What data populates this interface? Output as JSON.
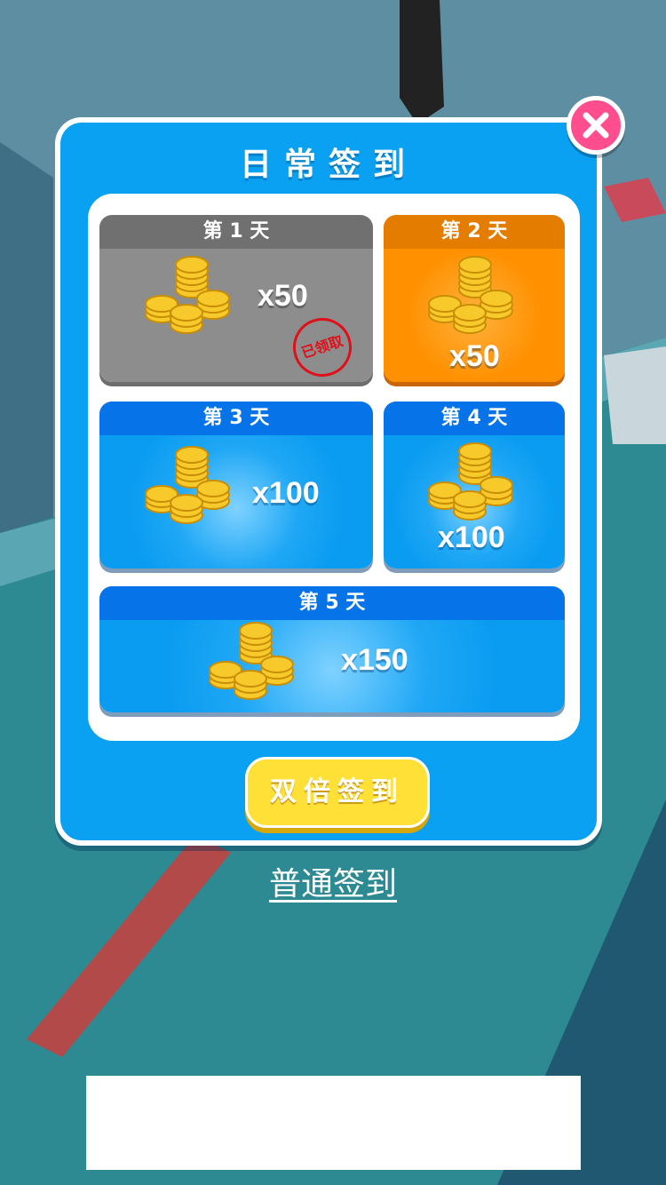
{
  "dialog": {
    "title": "日常签到",
    "close_icon": "close-icon"
  },
  "days": [
    {
      "label": "第 1 天",
      "amount": "x50",
      "state": "claimed",
      "stamp": "已领取"
    },
    {
      "label": "第 2 天",
      "amount": "x50",
      "state": "current"
    },
    {
      "label": "第 3 天",
      "amount": "x100",
      "state": "locked"
    },
    {
      "label": "第 4 天",
      "amount": "x100",
      "state": "locked"
    },
    {
      "label": "第 5 天",
      "amount": "x150",
      "state": "locked"
    }
  ],
  "buttons": {
    "double": "双倍签到",
    "normal": "普通签到"
  },
  "colors": {
    "dialog_bg": "#0aa1f3",
    "claimed": "#8d8d8d",
    "current": "#ff9000",
    "locked_header": "#0674e8",
    "double_button": "#ffe037",
    "close_button": "#ff4d8d"
  }
}
